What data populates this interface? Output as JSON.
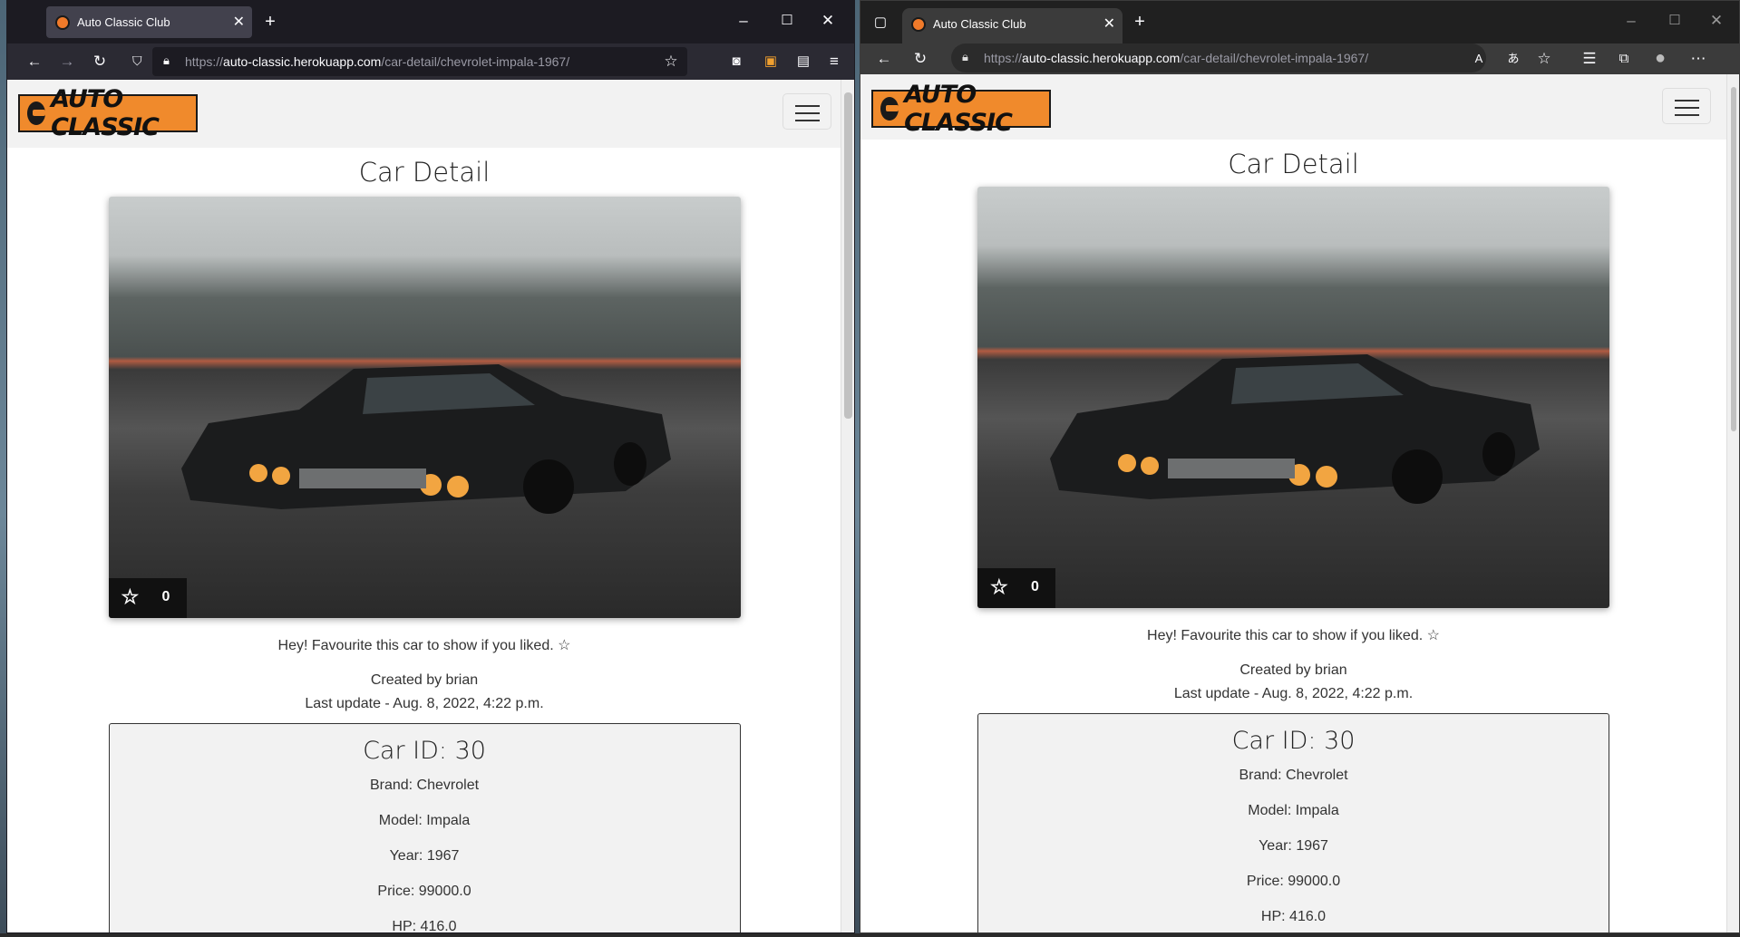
{
  "firefox": {
    "tab_title": "Auto Classic Club",
    "url_host": "https://auto-classic.herokuapp.com",
    "url_path": "/car-detail/chevrolet-impala-1967/"
  },
  "edge": {
    "tab_title": "Auto Classic Club",
    "url_host": "https://auto-classic.herokuapp.com",
    "url_path": "/car-detail/chevrolet-impala-1967/"
  },
  "page": {
    "logo_text": "AUTO CLASSIC",
    "title": "Car Detail",
    "favourite_count": "0",
    "favourite_prompt": "Hey! Favourite this car to show if you liked.",
    "created_by": "Created by brian",
    "last_update": "Last update - Aug. 8, 2022, 4:22 p.m.",
    "car_id": "Car ID: 30",
    "brand": "Brand: Chevrolet",
    "model": "Model: Impala",
    "year": "Year: 1967",
    "price": "Price: 99000.0",
    "hp": "HP: 416.0"
  },
  "colors": {
    "logo_bg": "#f08a2c",
    "ff_tabbar": "#1c1b22",
    "edge_tabbar": "#202020"
  },
  "icons": [
    "back-icon",
    "forward-icon",
    "reload-icon",
    "shield-icon",
    "lock-icon",
    "bookmark-star-icon",
    "pocket-icon",
    "extension-icon",
    "menu-icon",
    "minimize-icon",
    "maximize-icon",
    "close-icon",
    "new-tab-icon",
    "tab-actions-icon",
    "read-aloud-icon",
    "translate-icon",
    "favorites-add-icon",
    "favorites-icon",
    "collections-icon",
    "profile-icon",
    "more-icon",
    "star-icon"
  ]
}
